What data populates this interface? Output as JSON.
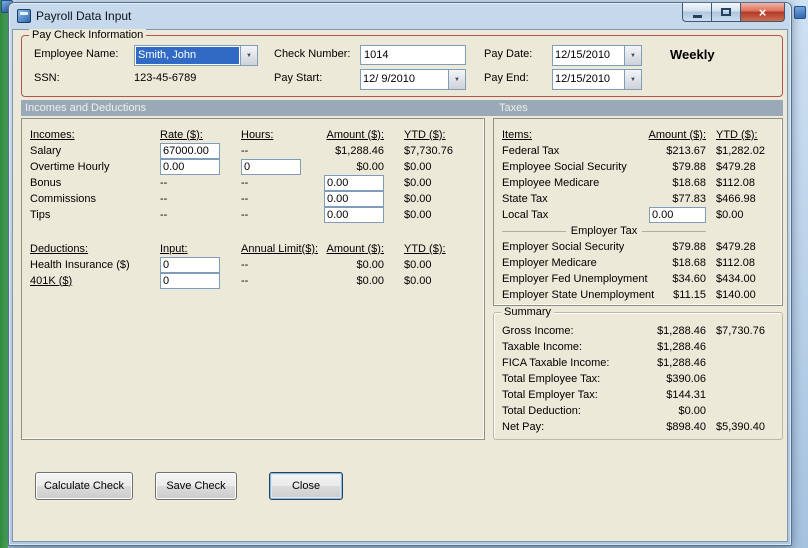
{
  "window": {
    "title": "Payroll Data Input"
  },
  "icons": {
    "close": "×",
    "dropdown_arrow": "▼"
  },
  "paycheck_info": {
    "group_title": "Pay Check Information",
    "employee_name_label": "Employee Name:",
    "employee_name_value": "Smith, John",
    "ssn_label": "SSN:",
    "ssn_value": "123-45-6789",
    "check_number_label": "Check Number:",
    "check_number_value": "1014",
    "pay_start_label": "Pay Start:",
    "pay_start_value": "12/ 9/2010",
    "pay_date_label": "Pay Date:",
    "pay_date_value": "12/15/2010",
    "pay_end_label": "Pay End:",
    "pay_end_value": "12/15/2010",
    "frequency": "Weekly"
  },
  "sections": {
    "incomes_deductions_header": "Incomes and Deductions",
    "taxes_header": "Taxes"
  },
  "incomes": {
    "headers": [
      "Incomes:",
      "Rate ($):",
      "Hours:",
      "Amount ($):",
      "YTD ($):"
    ],
    "rows": [
      {
        "label": "Salary",
        "rate": "67000.00",
        "hours": "--",
        "amount": "$1,288.46",
        "ytd": "$7,730.76"
      },
      {
        "label": "Overtime Hourly",
        "rate": "0.00",
        "hours": "0",
        "amount": "$0.00",
        "ytd": "$0.00"
      },
      {
        "label": "Bonus",
        "rate": "--",
        "hours": "--",
        "amount": "0.00",
        "ytd": "$0.00"
      },
      {
        "label": "Commissions",
        "rate": "--",
        "hours": "--",
        "amount": "0.00",
        "ytd": "$0.00"
      },
      {
        "label": "Tips",
        "rate": "--",
        "hours": "--",
        "amount": "0.00",
        "ytd": "$0.00"
      }
    ]
  },
  "deductions": {
    "headers": [
      "Deductions:",
      "Input:",
      "Annual Limit($):",
      "Amount ($):",
      "YTD ($):"
    ],
    "rows": [
      {
        "label": "Health Insurance  ($)",
        "input": "0",
        "limit": "--",
        "amount": "$0.00",
        "ytd": "$0.00"
      },
      {
        "label": "401K  ($)",
        "input": "0",
        "limit": "--",
        "amount": "$0.00",
        "ytd": "$0.00"
      }
    ]
  },
  "taxes": {
    "headers": [
      "Items:",
      "Amount ($):",
      "YTD ($):"
    ],
    "employee_rows": [
      {
        "label": "Federal Tax",
        "amount": "$213.67",
        "ytd": "$1,282.02"
      },
      {
        "label": "Employee Social Security",
        "amount": "$79.88",
        "ytd": "$479.28"
      },
      {
        "label": "Employee Medicare",
        "amount": "$18.68",
        "ytd": "$112.08"
      },
      {
        "label": "State Tax",
        "amount": "$77.83",
        "ytd": "$466.98"
      },
      {
        "label": "Local Tax",
        "amount": "0.00",
        "ytd": "$0.00"
      }
    ],
    "employer_header": "Employer Tax",
    "employer_rows": [
      {
        "label": "Employer Social Security",
        "amount": "$79.88",
        "ytd": "$479.28"
      },
      {
        "label": "Employer Medicare",
        "amount": "$18.68",
        "ytd": "$112.08"
      },
      {
        "label": "Employer Fed Unemployment",
        "amount": "$34.60",
        "ytd": "$434.00"
      },
      {
        "label": "Employer State Unemployment",
        "amount": "$11.15",
        "ytd": "$140.00"
      }
    ]
  },
  "summary": {
    "group_title": "Summary",
    "rows": [
      {
        "label": "Gross Income:",
        "amount": "$1,288.46",
        "ytd": "$7,730.76"
      },
      {
        "label": "Taxable Income:",
        "amount": "$1,288.46",
        "ytd": ""
      },
      {
        "label": "FICA Taxable Income:",
        "amount": "$1,288.46",
        "ytd": ""
      },
      {
        "label": "Total Employee Tax:",
        "amount": "$390.06",
        "ytd": ""
      },
      {
        "label": "Total Employer Tax:",
        "amount": "$144.31",
        "ytd": ""
      },
      {
        "label": "Total Deduction:",
        "amount": "$0.00",
        "ytd": ""
      },
      {
        "label": "Net Pay:",
        "amount": "$898.40",
        "ytd": "$5,390.40"
      }
    ]
  },
  "buttons": {
    "calculate": "Calculate Check",
    "save": "Save Check",
    "close": "Close"
  }
}
